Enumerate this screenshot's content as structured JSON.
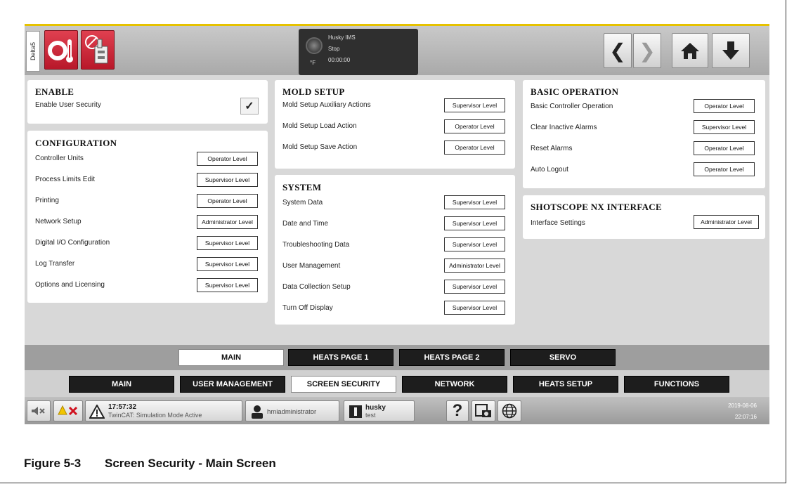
{
  "topbar": {
    "side_tab": "Delta5",
    "status": {
      "title": "Husky IMS",
      "state": "Stop",
      "unit": "°F",
      "time": "00:00:00"
    }
  },
  "enable": {
    "title": "ENABLE",
    "rows": [
      {
        "label": "Enable User Security",
        "checked": true
      }
    ]
  },
  "configuration": {
    "title": "CONFIGURATION",
    "rows": [
      {
        "label": "Controller Units",
        "level": "Operator Level"
      },
      {
        "label": "Process Limits Edit",
        "level": "Supervisor Level"
      },
      {
        "label": "Printing",
        "level": "Operator Level"
      },
      {
        "label": "Network Setup",
        "level": "Administrator Level"
      },
      {
        "label": "Digital I/O Configuration",
        "level": "Supervisor Level"
      },
      {
        "label": "Log Transfer",
        "level": "Supervisor Level"
      },
      {
        "label": "Options and Licensing",
        "level": "Supervisor Level"
      }
    ]
  },
  "mold_setup": {
    "title": "MOLD SETUP",
    "rows": [
      {
        "label": "Mold Setup Auxiliary Actions",
        "level": "Supervisor Level"
      },
      {
        "label": "Mold Setup Load Action",
        "level": "Operator Level"
      },
      {
        "label": "Mold Setup Save Action",
        "level": "Operator Level"
      }
    ]
  },
  "system": {
    "title": "SYSTEM",
    "rows": [
      {
        "label": "System Data",
        "level": "Supervisor Level"
      },
      {
        "label": "Date and Time",
        "level": "Supervisor Level"
      },
      {
        "label": "Troubleshooting Data",
        "level": "Supervisor Level"
      },
      {
        "label": "User Management",
        "level": "Administrator Level"
      },
      {
        "label": "Data Collection Setup",
        "level": "Supervisor Level"
      },
      {
        "label": "Turn Off Display",
        "level": "Supervisor Level"
      }
    ]
  },
  "basic_operation": {
    "title": "BASIC OPERATION",
    "rows": [
      {
        "label": "Basic Controller Operation",
        "level": "Operator Level"
      },
      {
        "label": "Clear Inactive Alarms",
        "level": "Supervisor Level"
      },
      {
        "label": "Reset Alarms",
        "level": "Operator Level"
      },
      {
        "label": "Auto Logout",
        "level": "Operator Level"
      }
    ]
  },
  "shotscope": {
    "title": "SHOTSCOPE NX INTERFACE",
    "rows": [
      {
        "label": "Interface Settings",
        "level": "Administrator Level"
      }
    ]
  },
  "page_tabs": [
    "MAIN",
    "HEATS PAGE 1",
    "HEATS PAGE 2",
    "SERVO"
  ],
  "section_tabs": [
    "MAIN",
    "USER MANAGEMENT",
    "SCREEN SECURITY",
    "NETWORK",
    "HEATS SETUP",
    "FUNCTIONS"
  ],
  "bottom": {
    "alarm_time": "17:57:32",
    "alarm_text": "TwinCAT: Simulation Mode Active",
    "user": "hmiadministrator",
    "machine_line1": "husky",
    "machine_line2": "test",
    "help": "?",
    "date": "2019-08-06",
    "time": "22:07:16"
  },
  "caption": {
    "number": "Figure 5-3",
    "title": "Screen Security - Main Screen"
  },
  "colors": {
    "accent_red": "#c8202f",
    "tab_dark": "#1d1d1d",
    "topbar_stripe": "#e6c200"
  }
}
